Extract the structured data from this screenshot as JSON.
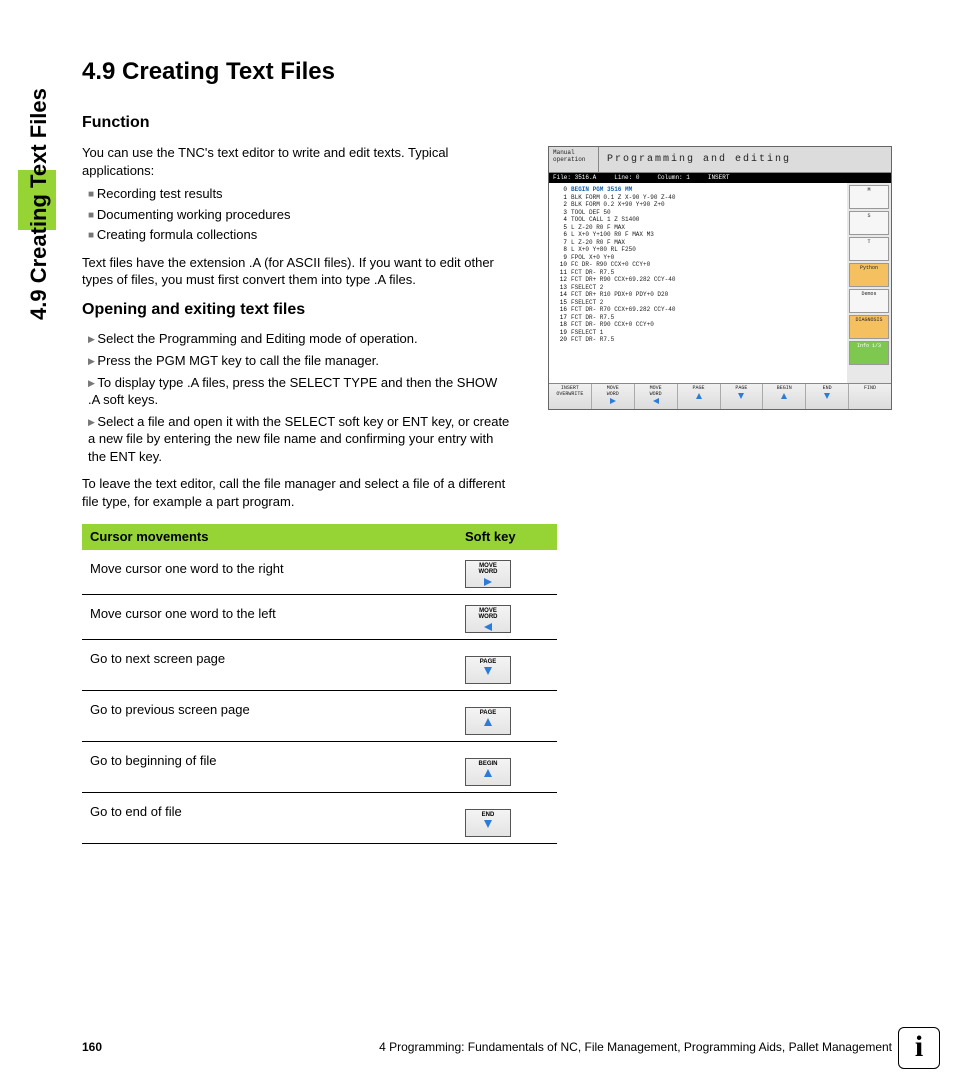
{
  "side_label": "4.9 Creating Text Files",
  "h1": "4.9  Creating Text Files",
  "sec1": {
    "h": "Function",
    "p1": "You can use the TNC's text editor to write and edit texts. Typical applications:",
    "bullets": [
      "Recording test results",
      "Documenting working procedures",
      "Creating formula collections"
    ],
    "p2": "Text files have the extension .A (for ASCII files). If you want to edit other types of files, you must first convert them into type .A files."
  },
  "sec2": {
    "h": "Opening and exiting text files",
    "steps": [
      "Select the Programming and Editing mode of operation.",
      "Press the PGM MGT key to call the file manager.",
      "To display type .A files, press the SELECT TYPE and then the SHOW .A soft keys.",
      "Select a file and open it with the SELECT soft key or ENT key, or create a new file by entering the new file name and confirming your entry with the ENT key."
    ],
    "p_after": "To leave the text editor, call the file manager and select a file of a different file type, for example a part program."
  },
  "table": {
    "head": [
      "Cursor movements",
      "Soft key"
    ],
    "rows": [
      {
        "t": "Move cursor one word to the right",
        "k": "MOVE WORD",
        "dir": "right"
      },
      {
        "t": "Move cursor one word to the left",
        "k": "MOVE WORD",
        "dir": "left"
      },
      {
        "t": "Go to next screen page",
        "k": "PAGE",
        "dir": "down"
      },
      {
        "t": "Go to previous screen page",
        "k": "PAGE",
        "dir": "up"
      },
      {
        "t": "Go to beginning of file",
        "k": "BEGIN",
        "dir": "up"
      },
      {
        "t": "Go to end of file",
        "k": "END",
        "dir": "down"
      }
    ]
  },
  "screenshot": {
    "mode": "Manual operation",
    "title": "Programming and editing",
    "bar": {
      "file": "File: 3516.A",
      "line": "Line:  0",
      "col": "Column:  1",
      "mode": "INSERT"
    },
    "code": [
      "BEGIN PGM 3516 MM",
      "BLK FORM 0.1 Z X-90 Y-90 Z-40",
      "BLK FORM 0.2 X+90 Y+90 Z+0",
      "TOOL DEF 50",
      "TOOL CALL 1 Z S1400",
      "L Z-20 R0 F MAX",
      "L X+0 Y+100 R0 F MAX M3",
      "L Z-20 R0 F MAX",
      "L X+0 Y+80 RL F250",
      "FPOL X+0 Y+0",
      "FC DR- R90 CCX+0 CCY+0",
      "FCT DR- R7.5",
      "FCT DR+ R90 CCX+69.282 CCY-40",
      "FSELECT 2",
      "FCT DR+ R10 PDX+0 PDY+0 D20",
      "FSELECT 2",
      "FCT DR- R70 CCX+69.282 CCY-40",
      "FCT DR- R7.5",
      "FCT DR- R90 CCX+0 CCY+0",
      "FSELECT 1",
      "FCT DR- R7.5"
    ],
    "side": [
      "M",
      "S",
      "T",
      "Python",
      "Demos",
      "DIAGNOSIS",
      "Info 1/3"
    ],
    "foot": [
      "INSERT OVERWRITE",
      "MOVE WORD",
      "MOVE WORD",
      "PAGE",
      "PAGE",
      "BEGIN",
      "END",
      "FIND"
    ],
    "foot_dir": [
      "",
      "right",
      "left",
      "up",
      "down",
      "up",
      "down",
      ""
    ]
  },
  "footer": {
    "page": "160",
    "chapter": "4 Programming: Fundamentals of NC, File Management, Programming Aids, Pallet Management"
  },
  "info_badge": "i"
}
